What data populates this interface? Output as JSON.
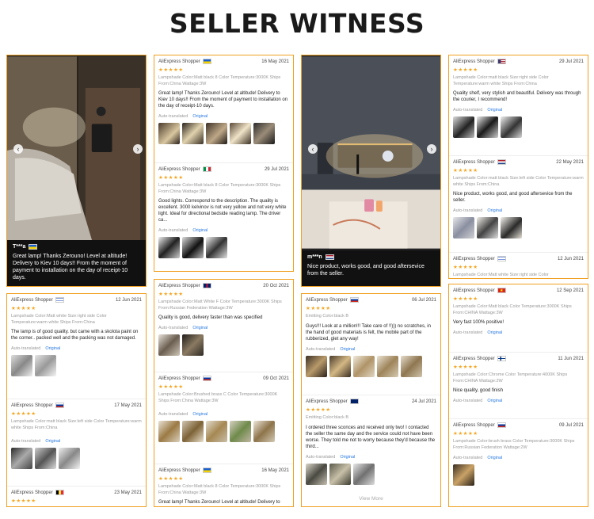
{
  "page_title": "SELLER WITNESS",
  "colors": {
    "accent_border": "#f0a020",
    "stars": "#f5a623",
    "link": "#2a7ae2"
  },
  "photo1": {
    "user": "T***a",
    "text": "Great lamp! Thanks Zerouno! Level at altitude! Delivery to Kiev 10 days!! From the moment of payment to installation on the day of receipt-10 days."
  },
  "photo2": {
    "user": "m***n",
    "text": "Nice product, works good, and good aftersevice from the seller."
  },
  "col2_top": [
    {
      "shopper": "AliExpress Shopper",
      "date": "16 May 2021",
      "stars": "★★★★★",
      "meta": "Lampshade Color:Matt black 8 Color Temperature:3000K Ships From:China Wattage:3W",
      "text": "Great lamp! Thanks Zerouno! Level at altitude! Delivery to Kiev 10 days!! From the moment of payment to installation on the day of receipt-10 days.",
      "auto": "Auto-translated",
      "original": "Original"
    },
    {
      "shopper": "AliExpress Shopper",
      "date": "29 Jul 2021",
      "stars": "★★★★★",
      "meta": "Lampshade Color:Matt black 8 Color Temperature:3000K Ships From:China Wattage:3W",
      "text": "Good lights. Correspond to the description. The quality is excellent. 3000 kelvinov is not very yellow and not very white light. Ideal for directional bedside reading lamp. The driver ca...",
      "auto": "Auto-translated",
      "original": "Original"
    }
  ],
  "col4_top": [
    {
      "shopper": "AliExpress Shopper",
      "date": "29 Jul 2021",
      "stars": "★★★★★",
      "meta": "Lampshade Color:matt black Size:right side Color Temperature:warm white Ships From:China",
      "text": "Quality shelf, very stylish and beautiful. Delivery was through the courier, I recommend!",
      "auto": "Auto-translated",
      "original": "Original"
    },
    {
      "shopper": "AliExpress Shopper",
      "date": "22 May 2021",
      "stars": "★★★★★",
      "meta": "Lampshade Color:matt black Size:left side Color Temperature:warm white Ships From:China",
      "text": "Nice product, works good, and good aftersevice from the seller.",
      "auto": "Auto-translated",
      "original": "Original"
    },
    {
      "shopper": "AliExpress Shopper",
      "date": "12 Jun 2021",
      "stars": "★★★★★",
      "meta": "Lampshade Color:Matt white Size:right side Color"
    }
  ],
  "col1_bottom": [
    {
      "shopper": "AliExpress Shopper",
      "date": "12 Jun 2021",
      "stars": "★★★★★",
      "meta": "Lampshade Color:Matt white Size:right side Color Temperature:warm white Ships From:China",
      "text": "The lamp is of good quality. but came with a skolota paint on the corner.. packed well and the packing was not damaged.",
      "auto": "Auto-translated",
      "original": "Original"
    },
    {
      "shopper": "AliExpress Shopper",
      "date": "17 May 2021",
      "stars": "★★★★★",
      "meta": "Lampshade Color:matt black Size:left side Color Temperature:warm white Ships From:China",
      "auto": "Auto-translated",
      "original": "Original"
    },
    {
      "shopper": "AliExpress Shopper",
      "date": "23 May 2021",
      "stars": "★★★★★"
    }
  ],
  "col2_bottom": [
    {
      "shopper": "AliExpress Shopper",
      "date": "20 Oct 2021",
      "stars": "★★★★★",
      "meta": "Lampshade Color:Matt White F Color Temperature:3000K Ships From:Russian Federation Wattage:3W",
      "text": "Quality is good, delivery faster than was specified",
      "auto": "Auto-translated",
      "original": "Original"
    },
    {
      "shopper": "AliExpress Shopper",
      "date": "09 Oct 2021",
      "stars": "★★★★★",
      "meta": "Lampshade Color:Brushed brass C Color Temperature:3000K Ships From:China Wattage:3W",
      "auto": "Auto-translated",
      "original": "Original"
    },
    {
      "shopper": "AliExpress Shopper",
      "date": "16 May 2021",
      "stars": "★★★★★",
      "meta": "Lampshade Color:Matt black 8 Color Temperature:3000K Ships From:China Wattage:3W",
      "text": "Great lamp! Thanks Zerouno! Level at altitude! Delivery to Kiev"
    }
  ],
  "col3_bottom": [
    {
      "shopper": "AliExpress Shopper",
      "date": "06 Jul 2021",
      "stars": "★★★★★",
      "meta": "Emitting Color:black B",
      "text": "Guys!!! Look at a million!!! Take care of !!))) no scratches, in the hand of good materials is felt, the mobile part of the rubberized, glet any way!",
      "auto": "Auto-translated",
      "original": "Original"
    },
    {
      "shopper": "AliExpress Shopper",
      "date": "24 Jul 2021",
      "stars": "★★★★★",
      "meta": "Emitting Color:black B",
      "text": "I ordered three sconces and received only two! I contacted the seller the same day and the service could not have been worse. They told me not to worry because they'd because the third...",
      "auto": "Auto-translated",
      "original": "Original"
    }
  ],
  "col3_viewmore": "View More",
  "col4_bottom": [
    {
      "shopper": "AliExpress Shopper",
      "date": "12 Sep 2021",
      "stars": "★★★★★",
      "meta": "Lampshade Color:Matt black Color Temperature:3000K Ships From:CHINA Wattage:3W",
      "text": "Very fast 100% positive!",
      "auto": "Auto-translated",
      "original": "Original"
    },
    {
      "shopper": "AliExpress Shopper",
      "date": "11 Jun 2021",
      "stars": "★★★★★",
      "meta": "Lampshade Color:Chrome Color Temperature:4000K Ships From:CHINA Wattage:2W",
      "text": "Nice quality, good finish",
      "auto": "Auto-translated",
      "original": "Original"
    },
    {
      "shopper": "AliExpress Shopper",
      "date": "09 Jul 2021",
      "stars": "★★★★★",
      "meta": "Lampshade Color:brush brass Color Temperature:3000K Ships From:Russian Federation Wattage:2W",
      "auto": "Auto-translated",
      "original": "Original"
    }
  ]
}
